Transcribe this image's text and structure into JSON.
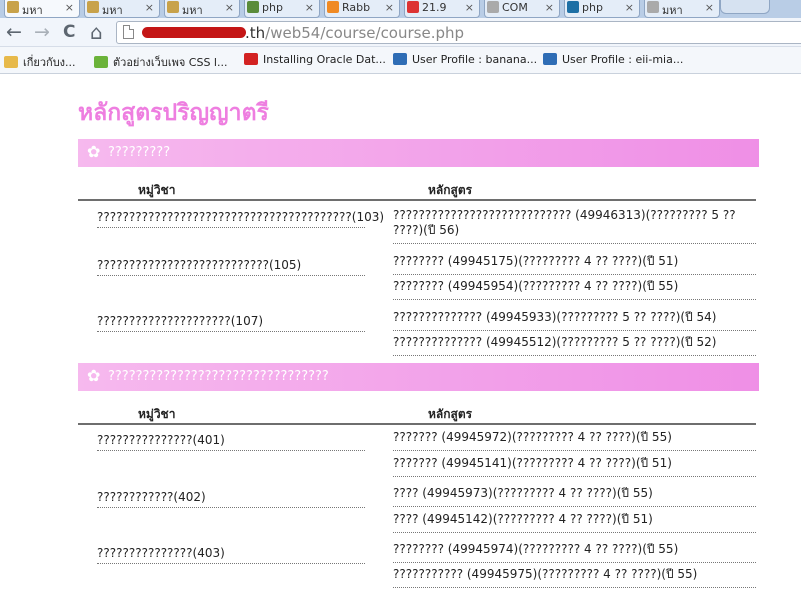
{
  "browser": {
    "tabs": [
      {
        "label": "มหา",
        "icon_color": "#c8a24a",
        "active": true
      },
      {
        "label": "มหา",
        "icon_color": "#c8a24a"
      },
      {
        "label": "มหา",
        "icon_color": "#c8a24a"
      },
      {
        "label": "php",
        "icon_color": "#5b8c3a"
      },
      {
        "label": "Rabb",
        "icon_color": "#f08a24"
      },
      {
        "label": "21.9",
        "icon_color": "#d33"
      },
      {
        "label": "COM",
        "icon_color": "#aaa"
      },
      {
        "label": "php",
        "icon_color": "#1d6fa5"
      },
      {
        "label": "มหา",
        "icon_color": "#aaa"
      }
    ],
    "tab_close": "×",
    "nav": {
      "back": "←",
      "forward": "→",
      "reload": "C",
      "home": "⌂"
    },
    "url": {
      "host_visible": ".th",
      "path": "/web54/course/course.php"
    },
    "bookmarks": [
      {
        "label": "เกี่ยวกับง...",
        "icon": "folder-icon",
        "icon_color": "#e7b94a"
      },
      {
        "label": "ตัวอย่างเว็บเพจ CSS l...",
        "icon": "star-icon",
        "icon_color": "#6bb33a"
      },
      {
        "label": "Installing Oracle Dat...",
        "icon": "oracle-icon",
        "icon_color": "#d32222"
      },
      {
        "label": "User Profile : banana...",
        "icon": "profile-icon",
        "icon_color": "#2f6db5"
      },
      {
        "label": "User Profile : eii-mia...",
        "icon": "profile-icon",
        "icon_color": "#2f6db5"
      }
    ]
  },
  "page": {
    "title": "หลักสูตรปริญญาตรี",
    "accent_color": "#ee7ee0",
    "gear_icon": "✿",
    "col_group": "หมู่วิชา",
    "col_course": "หลักสูตร",
    "sections": [
      {
        "title": "?????????",
        "groups": [
          {
            "name": "????????????????????????????????????????(103)",
            "courses": [
              "???????????????????????????? (49946313)(????????? 5 ?? ????)(ปี 56)"
            ]
          },
          {
            "name": "???????????????????????????(105)",
            "courses": [
              "???????? (49945175)(????????? 4 ?? ????)(ปี 51)",
              "???????? (49945954)(????????? 4 ?? ????)(ปี 55)"
            ]
          },
          {
            "name": "?????????????????????(107)",
            "courses": [
              "?????????????? (49945933)(????????? 5 ?? ????)(ปี 54)",
              "?????????????? (49945512)(????????? 5 ?? ????)(ปี 52)"
            ]
          }
        ]
      },
      {
        "title": "????????????????????????????????",
        "groups": [
          {
            "name": "???????????????(401)",
            "courses": [
              "??????? (49945972)(????????? 4 ?? ????)(ปี 55)",
              "??????? (49945141)(????????? 4 ?? ????)(ปี 51)"
            ]
          },
          {
            "name": "????????????(402)",
            "courses": [
              "???? (49945973)(????????? 4 ?? ????)(ปี 55)",
              "???? (49945142)(????????? 4 ?? ????)(ปี 51)"
            ]
          },
          {
            "name": "???????????????(403)",
            "courses": [
              "???????? (49945974)(????????? 4 ?? ????)(ปี 55)",
              "??????????? (49945975)(????????? 4 ?? ????)(ปี 55)"
            ]
          }
        ]
      }
    ]
  }
}
